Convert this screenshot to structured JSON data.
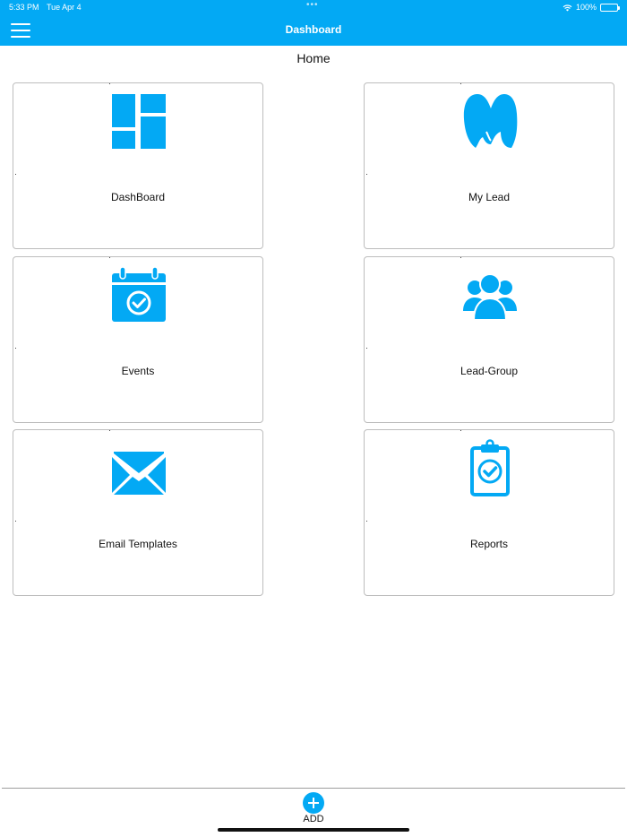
{
  "status": {
    "time": "5:33 PM",
    "date": "Tue Apr 4",
    "battery": "100%"
  },
  "nav": {
    "title": "Dashboard"
  },
  "page": {
    "title": "Home"
  },
  "cards": [
    {
      "label": "DashBoard",
      "icon": "dashboard-grid-icon"
    },
    {
      "label": "My Lead",
      "icon": "my-lead-logo-icon"
    },
    {
      "label": "Events",
      "icon": "calendar-check-icon"
    },
    {
      "label": "Lead-Group",
      "icon": "users-group-icon"
    },
    {
      "label": "Email Templates",
      "icon": "envelope-icon"
    },
    {
      "label": "Reports",
      "icon": "clipboard-check-icon"
    }
  ],
  "bottom": {
    "add_label": "ADD"
  },
  "colors": {
    "primary": "#03a9f4",
    "border": "#bdbdbd",
    "text": "#111111"
  }
}
